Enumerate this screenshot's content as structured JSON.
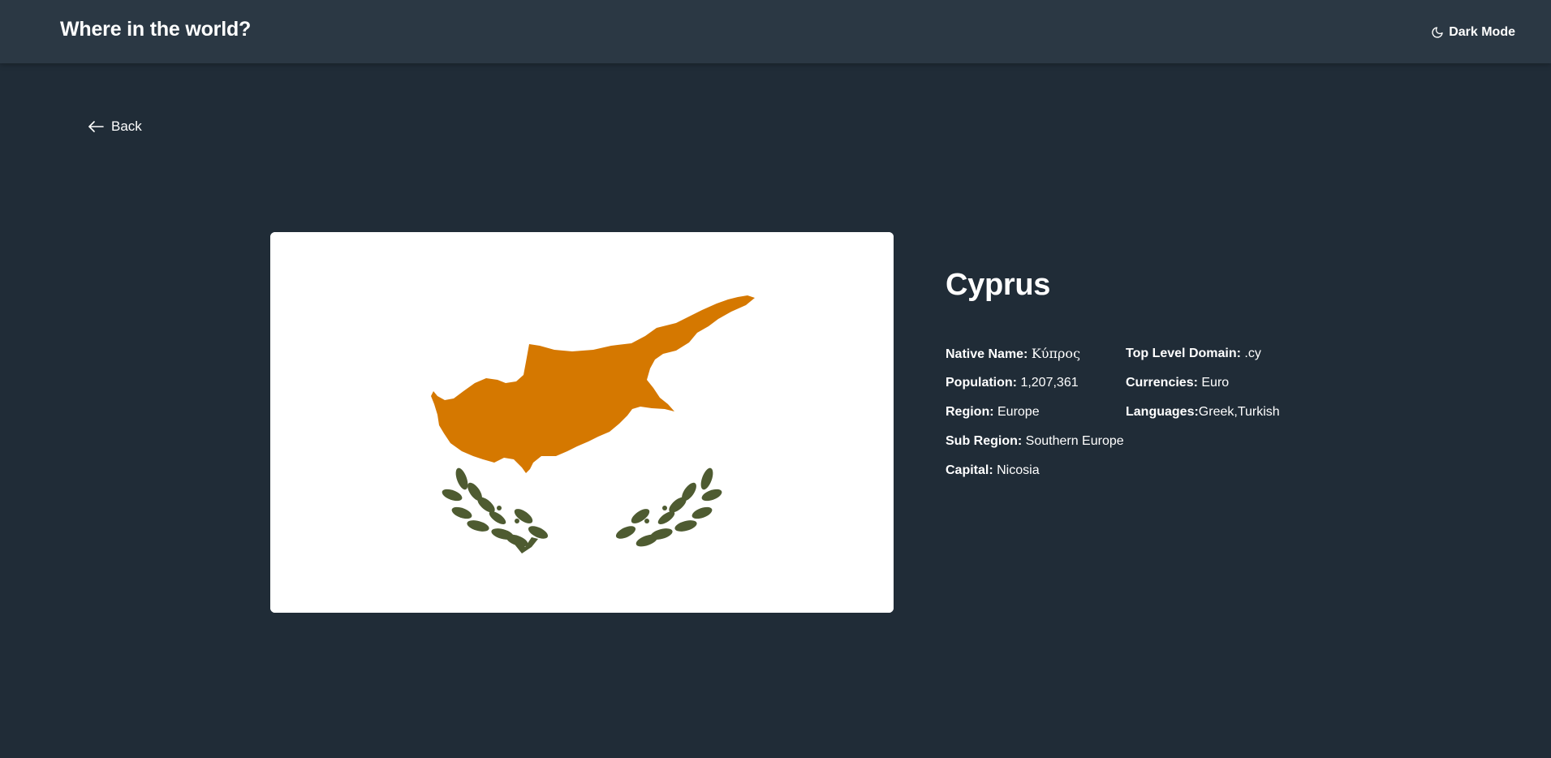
{
  "header": {
    "title": "Where in the world?",
    "theme_toggle_label": "Dark Mode",
    "theme_icon": "moon-icon"
  },
  "back": {
    "label": "Back",
    "icon": "arrow-left-icon"
  },
  "flag": {
    "country": "Cyprus",
    "colors": {
      "background": "#ffffff",
      "island": "#d57800",
      "olive_branches": "#4e5b31"
    }
  },
  "country": {
    "name": "Cyprus",
    "left_facts": [
      {
        "label": "Native Name:",
        "value": "Κύπρος"
      },
      {
        "label": "Population:",
        "value": "1,207,361"
      },
      {
        "label": "Region:",
        "value": "Europe"
      },
      {
        "label": "Sub Region:",
        "value": "Southern Europe"
      },
      {
        "label": "Capital:",
        "value": "Nicosia"
      }
    ],
    "right_facts": [
      {
        "label": "Top Level Domain:",
        "value": ".cy"
      },
      {
        "label": "Currencies:",
        "value": "Euro"
      },
      {
        "label": "Languages:",
        "value": "Greek,Turkish"
      }
    ]
  },
  "colors": {
    "page_background": "#202c37",
    "header_background": "#2b3844",
    "text": "#ffffff"
  }
}
